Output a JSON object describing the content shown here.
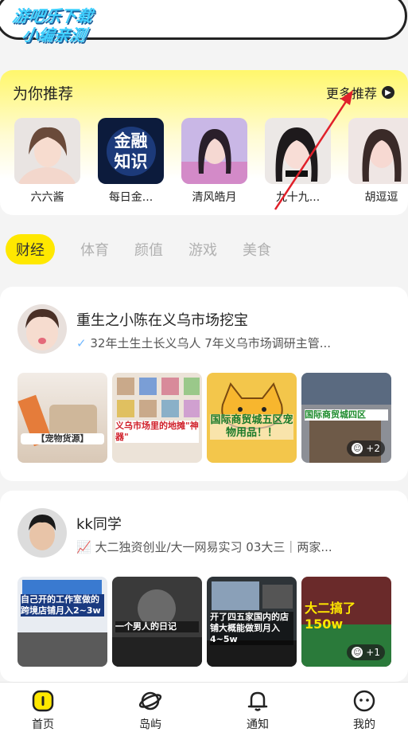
{
  "watermark": {
    "line1": "游吧乐下载",
    "line2": "小编亲测"
  },
  "recommend": {
    "title": "为你推荐",
    "more_label": "更多推荐",
    "anchors": [
      {
        "name": "六六酱"
      },
      {
        "name": "每日金...",
        "logo_text": "金融知识"
      },
      {
        "name": "清风皓月"
      },
      {
        "name": "九十九..."
      },
      {
        "name": "胡逗逗"
      }
    ]
  },
  "tabs": [
    {
      "label": "财经",
      "active": true
    },
    {
      "label": "体育"
    },
    {
      "label": "颜值"
    },
    {
      "label": "游戏"
    },
    {
      "label": "美食"
    }
  ],
  "posts": [
    {
      "title": "重生之小陈在义乌市场挖宝",
      "subtitle": "32年土生土长义乌人  7年义乌市场调研主管...",
      "thumb_labels": [
        "【宠物货源】",
        "义乌市场里的地摊\"神器\"",
        "国际商贸城五区宠物用品！！",
        "国际商贸城四区"
      ],
      "more_count": "+2"
    },
    {
      "title": "kk同学",
      "subtitle": "大二独资创业/大一网易实习  03大三｜两家...",
      "thumb_labels": [
        "自己开的工作室做的跨境店铺月入2~3w",
        "一个男人的日记",
        "开了四五家国内的店铺大概能做到月入4~5w",
        "大二搞了150w"
      ],
      "more_count": "+1"
    }
  ],
  "nav": [
    {
      "label": "首页"
    },
    {
      "label": "岛屿"
    },
    {
      "label": "通知"
    },
    {
      "label": "我的"
    }
  ],
  "colors": {
    "accent": "#ffe800",
    "check": "#6fb7ff",
    "arrow": "#e0202a"
  }
}
